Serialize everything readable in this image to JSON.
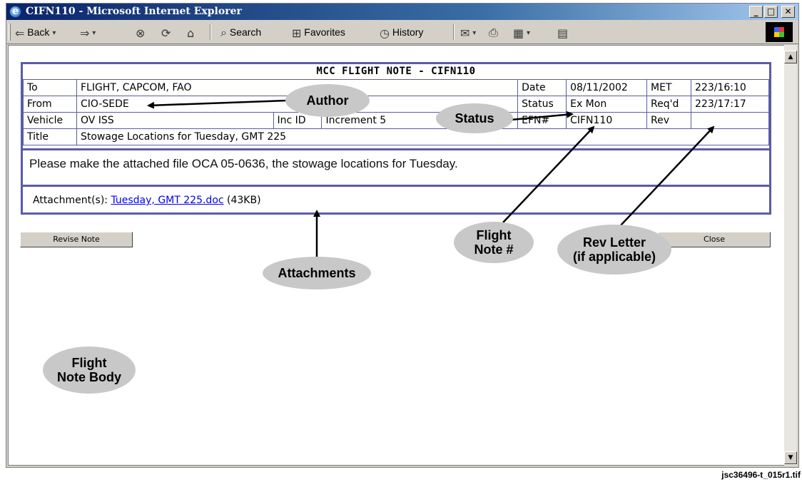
{
  "window": {
    "title": "CIFN110 - Microsoft Internet Explorer",
    "min_glyph": "_",
    "max_glyph": "□",
    "close_glyph": "✕"
  },
  "toolbar": {
    "back": "Back",
    "search": "Search",
    "favorites": "Favorites",
    "history": "History"
  },
  "note": {
    "title": "MCC FLIGHT NOTE - CIFN110",
    "to_label": "To",
    "to_value": "FLIGHT, CAPCOM, FAO",
    "date_label": "Date",
    "date_value": "08/11/2002",
    "met_label": "MET",
    "met_value": "223/16:10",
    "from_label": "From",
    "from_value": "CIO-SEDE",
    "status_label": "Status",
    "status_value": "Ex Mon",
    "reqd_label": "Req'd",
    "reqd_value": "223/17:17",
    "vehicle_label": "Vehicle",
    "vehicle_value": "OV ISS",
    "incid_label": "Inc ID",
    "incid_value": "Increment 5",
    "efn_label": "EFN#",
    "efn_value": "CIFN110",
    "rev_label": "Rev",
    "rev_value": "",
    "title_label": "Title",
    "title_value": "Stowage Locations for Tuesday, GMT 225",
    "body": "Please make the attached file OCA 05-0636, the stowage locations for Tuesday.",
    "attach_label": "Attachment(s):",
    "attach_link": "Tuesday, GMT 225.doc",
    "attach_size": "(43KB)"
  },
  "buttons": {
    "revise": "Revise Note",
    "close": "Close"
  },
  "callouts": {
    "author": "Author",
    "status": "Status",
    "attachments": "Attachments",
    "flight_note_line1": "Flight",
    "flight_note_line2": "Note #",
    "rev_line1": "Rev Letter",
    "rev_line2": "(if applicable)",
    "body_line1": "Flight",
    "body_line2": "Note Body"
  },
  "filename": "jsc36496-t_015r1.tif"
}
